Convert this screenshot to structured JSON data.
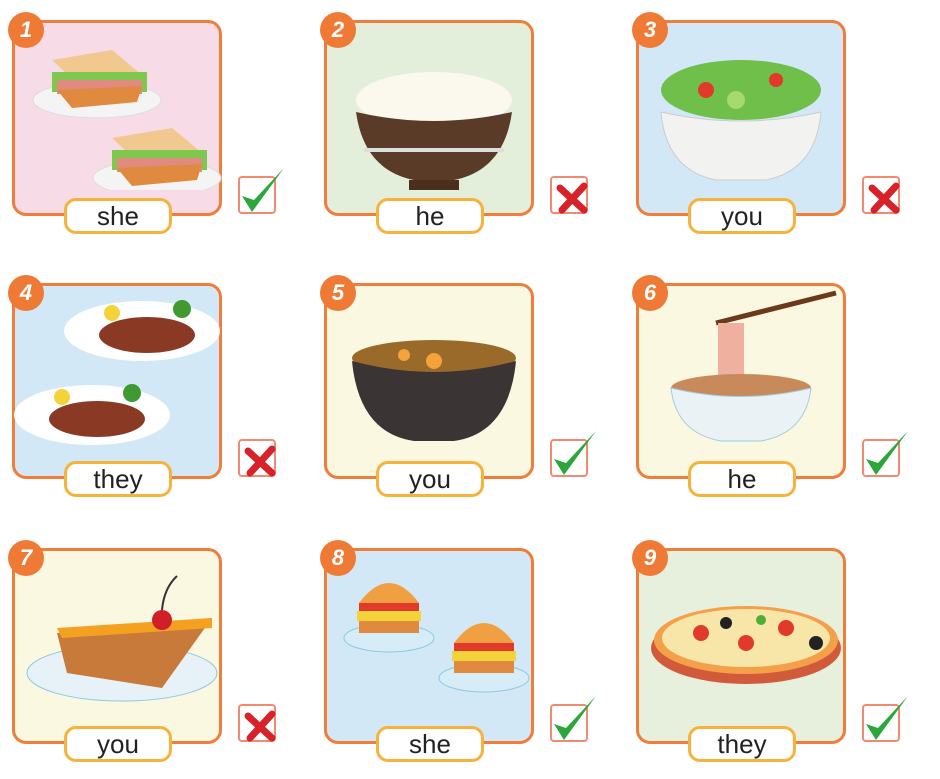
{
  "exercise": {
    "items": [
      {
        "number": "1",
        "food": "sandwiches",
        "label": "she",
        "mark": "correct",
        "mark_icon": "check-icon",
        "bg": "#f7dbe6"
      },
      {
        "number": "2",
        "food": "rice",
        "label": "he",
        "mark": "incorrect",
        "mark_icon": "cross-icon",
        "bg": "#e3eedb"
      },
      {
        "number": "3",
        "food": "salad",
        "label": "you",
        "mark": "incorrect",
        "mark_icon": "cross-icon",
        "bg": "#d3e8f6"
      },
      {
        "number": "4",
        "food": "steaks",
        "label": "they",
        "mark": "incorrect",
        "mark_icon": "cross-icon",
        "bg": "#d3e8f6"
      },
      {
        "number": "5",
        "food": "soup",
        "label": "you",
        "mark": "correct",
        "mark_icon": "check-icon",
        "bg": "#faf8e0"
      },
      {
        "number": "6",
        "food": "noodles",
        "label": "he",
        "mark": "correct",
        "mark_icon": "check-icon",
        "bg": "#faf8e0"
      },
      {
        "number": "7",
        "food": "pie",
        "label": "you",
        "mark": "incorrect",
        "mark_icon": "cross-icon",
        "bg": "#faf8e0"
      },
      {
        "number": "8",
        "food": "burgers",
        "label": "she",
        "mark": "correct",
        "mark_icon": "check-icon",
        "bg": "#d3e8f6"
      },
      {
        "number": "9",
        "food": "pizza",
        "label": "they",
        "mark": "correct",
        "mark_icon": "check-icon",
        "bg": "#e7f0dd"
      }
    ]
  },
  "colors": {
    "border": "#f07d3a",
    "badge": "#ef7a36",
    "label_border": "#f7b23b",
    "check": "#2aa63a",
    "cross": "#d8222a"
  }
}
